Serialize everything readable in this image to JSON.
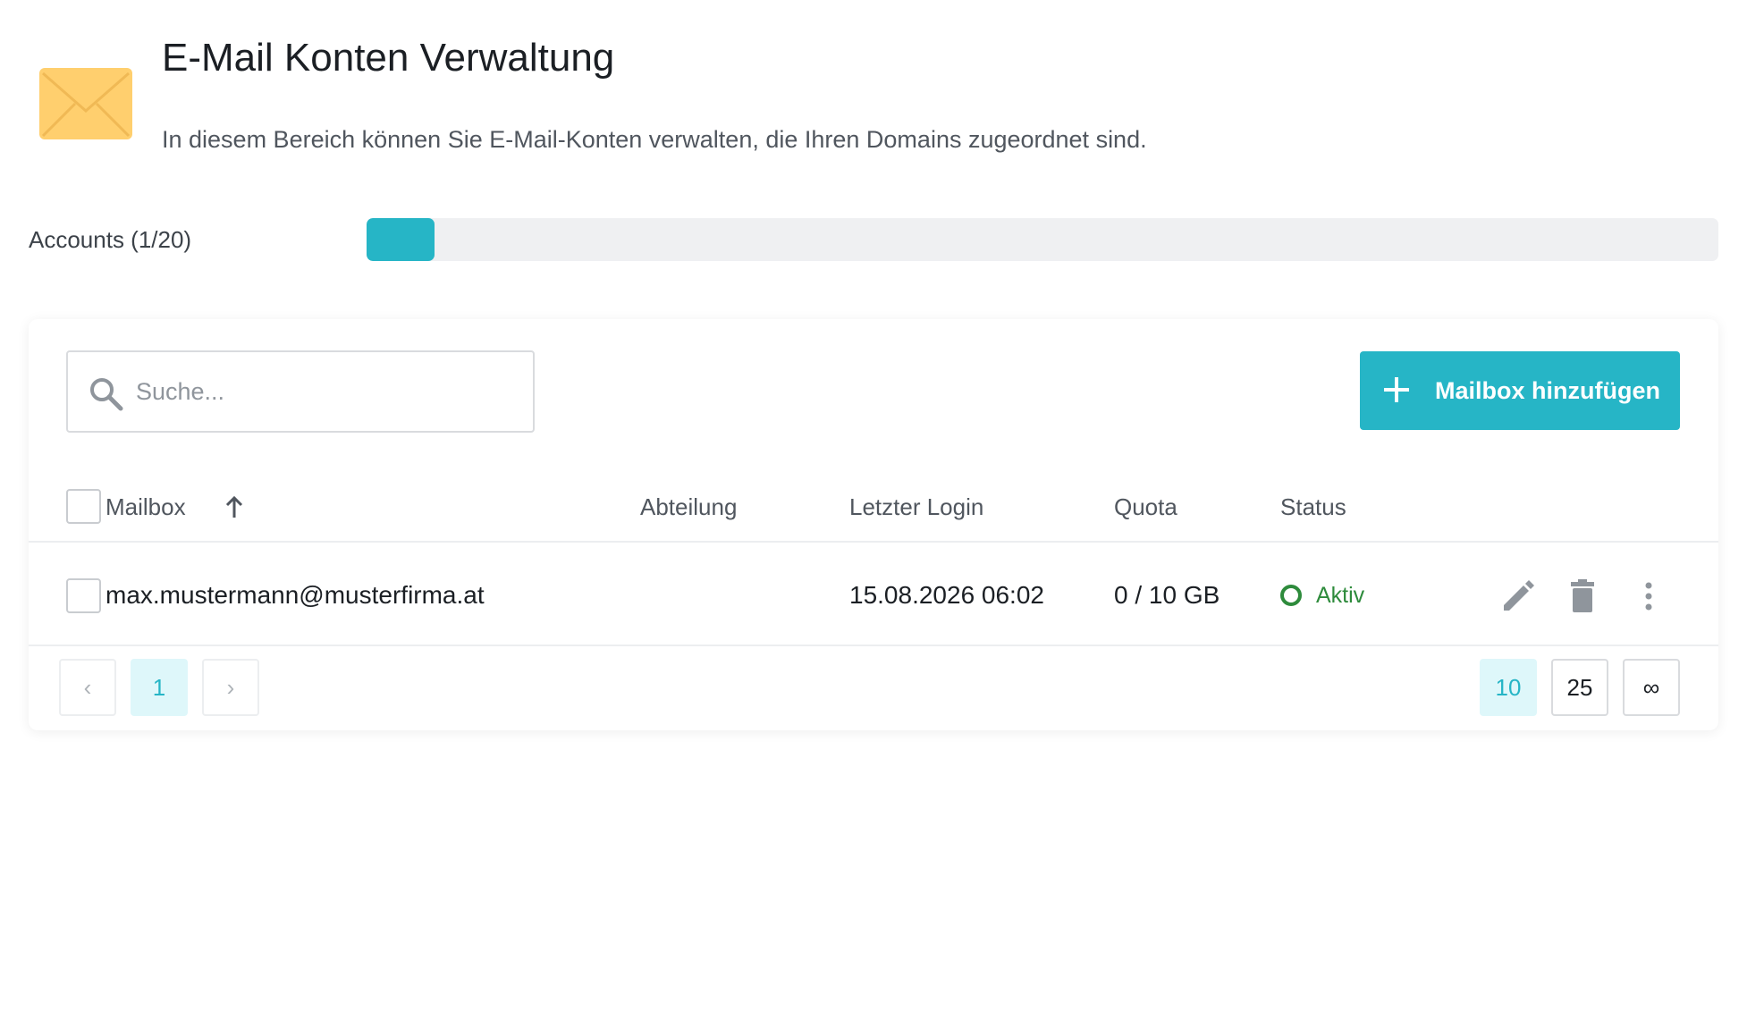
{
  "header": {
    "title": "E-Mail Konten Verwaltung",
    "description": "In diesem Bereich können Sie E-Mail-Konten verwalten, die Ihren Domains zugeordnet sind.",
    "icon": "envelope-icon"
  },
  "quota": {
    "label": "Accounts (1/20)",
    "used": 1,
    "total": 20,
    "fraction": 0.05
  },
  "toolbar": {
    "search_placeholder": "Suche...",
    "add_label": "Mailbox hinzufügen"
  },
  "table": {
    "columns": {
      "mailbox": "Mailbox",
      "department": "Abteilung",
      "last_login": "Letzter Login",
      "quota": "Quota",
      "status": "Status"
    },
    "sort": {
      "column": "mailbox",
      "direction": "ascending"
    },
    "rows": [
      {
        "mailbox": "max.mustermann@musterfirma.at",
        "department": "",
        "last_login": "15.08.2026 06:02",
        "quota": "0 / 10 GB",
        "status": "Aktiv"
      }
    ]
  },
  "pagination": {
    "prev": "‹",
    "next": "›",
    "current_page": "1",
    "page_sizes": [
      "10",
      "25",
      "∞"
    ],
    "selected_size": "10"
  },
  "colors": {
    "accent": "#26b5c6",
    "status_active": "#2e8b3c",
    "envelope": "#ffcf6e"
  }
}
